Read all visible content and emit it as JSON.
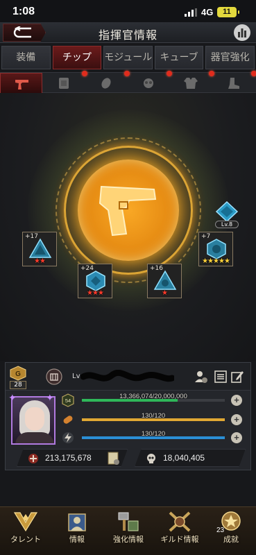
{
  "status_bar": {
    "time": "1:08",
    "network": "4G",
    "battery": "11"
  },
  "header": {
    "title": "指揮官情報"
  },
  "tabs": [
    {
      "label": "装備"
    },
    {
      "label": "チップ"
    },
    {
      "label": "モジュール"
    },
    {
      "label": "キューブ"
    },
    {
      "label": "器官強化"
    }
  ],
  "active_tab": "チップ",
  "chip_categories": [
    {
      "icon": "pistol-icon",
      "active": true,
      "badge": false
    },
    {
      "icon": "armor-icon",
      "active": false,
      "badge": true
    },
    {
      "icon": "ammo-icon",
      "active": false,
      "badge": true
    },
    {
      "icon": "gasmask-icon",
      "active": false,
      "badge": true
    },
    {
      "icon": "jacket-icon",
      "active": false,
      "badge": true
    },
    {
      "icon": "boots-icon",
      "active": false,
      "badge": true
    }
  ],
  "core_level": {
    "label": "Lv.8"
  },
  "chips": [
    {
      "level": "+17",
      "stars": 2,
      "star_color": "red"
    },
    {
      "level": "+7",
      "stars": 5,
      "star_color": "gold"
    },
    {
      "level": "+24",
      "stars": 3,
      "star_color": "red"
    },
    {
      "level": "+16",
      "stars": 1,
      "star_color": "red"
    }
  ],
  "player": {
    "rank": "28",
    "name_prefix": "Lv",
    "avatar_level": "54",
    "exp": {
      "text": "13,366,074/20,000,000",
      "fraction": 0.668,
      "color": "#2fb85a"
    },
    "stamina": {
      "text": "130/120",
      "fraction": 1.0,
      "color": "#e0a834"
    },
    "energy": {
      "text": "130/120",
      "fraction": 1.0,
      "color": "#2b8fd6"
    },
    "combat_power": "213,175,678",
    "kills": "18,040,405"
  },
  "bottom_nav": [
    {
      "label": "タレント",
      "icon": "talent-icon"
    },
    {
      "label": "情報",
      "icon": "info-icon"
    },
    {
      "label": "強化情報",
      "icon": "upgrade-icon"
    },
    {
      "label": "ギルド情報",
      "icon": "guild-icon"
    },
    {
      "label": "成就",
      "icon": "achievement-icon",
      "badge": "23"
    }
  ]
}
